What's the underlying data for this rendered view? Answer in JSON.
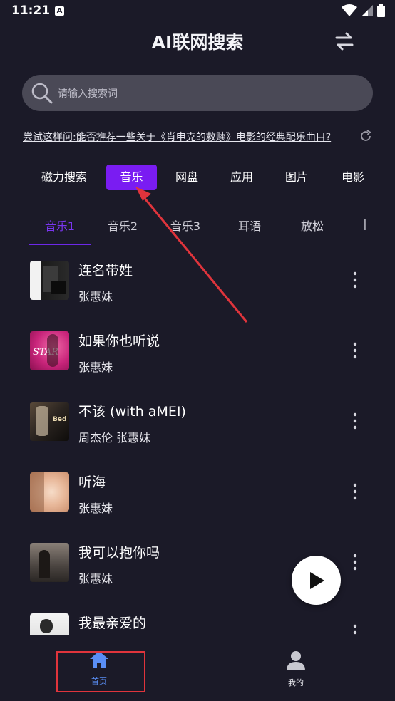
{
  "status_bar": {
    "time": "11:21",
    "a_icon": "A"
  },
  "header": {
    "title": "AI联网搜索",
    "switch_icon": "swap-arrows-icon"
  },
  "search": {
    "placeholder": "请输入搜索词",
    "icon": "search-icon"
  },
  "suggestion": {
    "text": "尝试这样问:能否推荐一些关于《肖申克的救赎》电影的经典配乐曲目?",
    "icon": "refresh-icon"
  },
  "categories": {
    "items": [
      "磁力搜索",
      "音乐",
      "网盘",
      "应用",
      "图片",
      "电影"
    ],
    "active": "音乐"
  },
  "subtabs": {
    "items": [
      "音乐1",
      "音乐2",
      "音乐3",
      "耳语",
      "放松"
    ],
    "active": "音乐1"
  },
  "songs": [
    {
      "title": "连名带姓",
      "artist": "张惠妹"
    },
    {
      "title": "如果你也听说",
      "artist": "张惠妹"
    },
    {
      "title": "不该 (with aMEI)",
      "artist": "周杰伦 张惠妹"
    },
    {
      "title": "听海",
      "artist": "张惠妹"
    },
    {
      "title": "我可以抱你吗",
      "artist": "张惠妹"
    },
    {
      "title": "我最亲爱的",
      "artist": ""
    }
  ],
  "bottom_nav": {
    "home_label": "首页",
    "mine_label": "我的"
  },
  "colors": {
    "background": "#1b1a28",
    "accent": "#7a1cf2",
    "active_tab": "#7a35f0",
    "nav_active": "#5a8ef5",
    "annotation": "#e0343c"
  }
}
